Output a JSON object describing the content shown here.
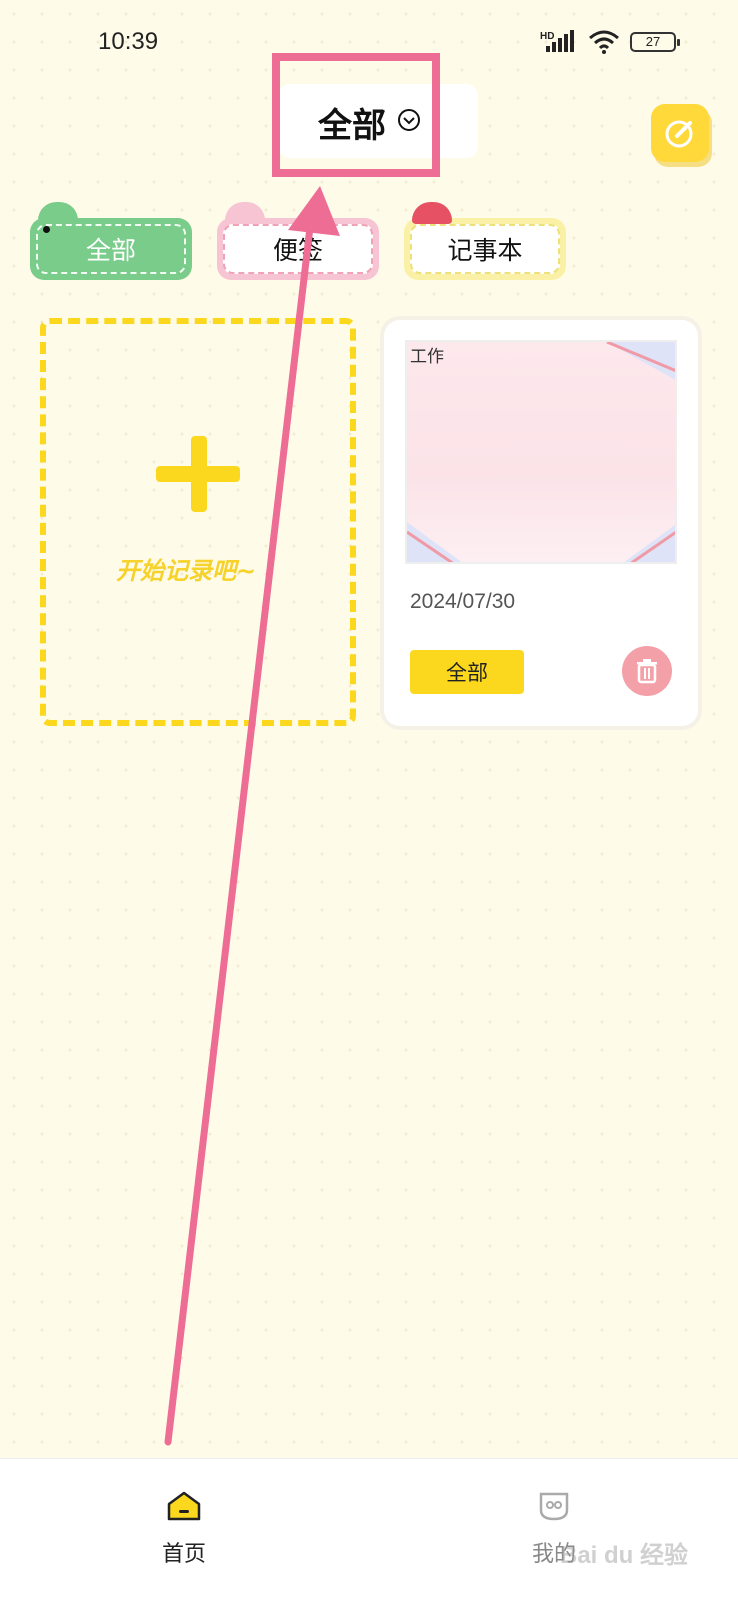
{
  "status_bar": {
    "time": "10:39",
    "network": "HD",
    "battery": "27"
  },
  "header": {
    "title": "全部"
  },
  "tabs": [
    {
      "label": "全部",
      "color": "#79cc8a"
    },
    {
      "label": "便签",
      "color": "#f7c4d3"
    },
    {
      "label": "记事本",
      "color": "#fbf1a6"
    }
  ],
  "add_card": {
    "label": "开始记录吧~"
  },
  "note": {
    "tag": "工作",
    "date": "2024/07/30",
    "category": "全部"
  },
  "nav": [
    {
      "label": "首页"
    },
    {
      "label": "我的"
    }
  ],
  "watermark": "Bai du 经验",
  "colors": {
    "accent": "#fbd81d",
    "annotation": "#ee6d95",
    "background": "#fffbe9"
  }
}
